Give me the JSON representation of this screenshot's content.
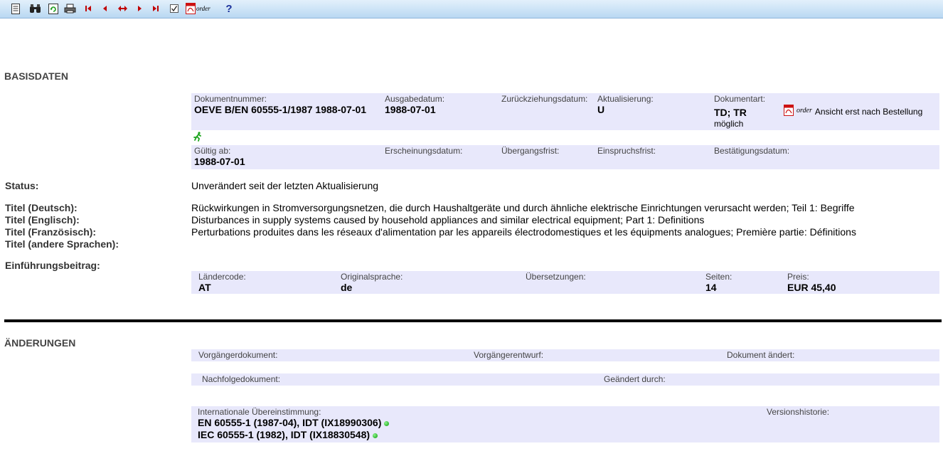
{
  "toolbar": {
    "items": [
      {
        "icon": "document-properties-icon"
      },
      {
        "icon": "binoculars-search-icon"
      },
      {
        "icon": "refresh-icon"
      },
      {
        "icon": "print-icon"
      },
      {
        "icon": "first-record-icon"
      },
      {
        "icon": "previous-record-icon"
      },
      {
        "icon": "switch-icon"
      },
      {
        "icon": "next-record-icon"
      },
      {
        "icon": "last-record-icon"
      },
      {
        "icon": "checkbox-icon"
      },
      {
        "icon": "pdf-icon"
      }
    ],
    "order_label": "order",
    "help_label": "?"
  },
  "basisdaten": {
    "title": "BASISDATEN",
    "dokumentnummer_label": "Dokumentnummer:",
    "dokumentnummer_value": "OEVE B/EN 60555-1/1987 1988-07-01",
    "ausgabedatum_label": "Ausgabedatum:",
    "ausgabedatum_value": "1988-07-01",
    "zurueckziehungsdatum_label": "Zurückziehungsdatum:",
    "aktualisierung_label": "Aktualisierung:",
    "aktualisierung_value": "U",
    "dokumentart_label": "Dokumentart:",
    "dokumentart_value": "TD; TR",
    "dokumentart_note": "möglich",
    "order_label": "order",
    "order_note": "Ansicht erst nach Bestellung",
    "gueltig_label": "Gültig ab:",
    "gueltig_value": "1988-07-01",
    "erscheinungsdatum_label": "Erscheinungsdatum:",
    "uebergangsfrist_label": "Übergangsfrist:",
    "einspruchsfrist_label": "Einspruchsfrist:",
    "bestaetigungsdatum_label": "Bestätigungsdatum:",
    "status_label": "Status:",
    "status_value": "Unverändert seit der letzten Aktualisierung",
    "titel_de_label": "Titel (Deutsch):",
    "titel_de_value": "Rückwirkungen in Stromversorgungsnetzen, die durch Haushaltgeräte und durch ähnliche elektrische Einrichtungen verursacht werden; Teil 1: Begriffe",
    "titel_en_label": "Titel (Englisch):",
    "titel_en_value": "Disturbances in supply systems caused by household appliances and similar electrical equipment; Part 1: Definitions",
    "titel_fr_label": "Titel (Französisch):",
    "titel_fr_value": "Perturbations produites dans les réseaux d'alimentation par les appareils électrodomestiques et les équipments analogues; Première partie: Définitions",
    "titel_other_label": "Titel (andere Sprachen):",
    "einfuehrung_label": "Einführungsbeitrag:",
    "laendercode_label": "Ländercode:",
    "laendercode_value": "AT",
    "originalsprache_label": "Originalsprache:",
    "originalsprache_value": "de",
    "uebersetzungen_label": "Übersetzungen:",
    "seiten_label": "Seiten:",
    "seiten_value": "14",
    "preis_label": "Preis:",
    "preis_value": "EUR 45,40"
  },
  "aenderungen": {
    "title": "ÄNDERUNGEN",
    "vorgaenger_label": "Vorgängerdokument:",
    "vorgaengerentwurf_label": "Vorgängerentwurf:",
    "dokument_aendert_label": "Dokument ändert:",
    "nachfolge_label": "Nachfolgedokument:",
    "geaendert_label": "Geändert durch:",
    "international_label": "Internationale Übereinstimmung:",
    "international_items": [
      "EN 60555-1 (1987-04), IDT (IX18990306)",
      "IEC 60555-1 (1982), IDT (IX18830548)"
    ],
    "versionshistorie_label": "Versionshistorie:"
  },
  "colors": {
    "box": "#e8e8fb",
    "toolbar_top": "#e3f0fb",
    "toolbar_bottom": "#b9d8f2",
    "status_dot": "#0a9a0a",
    "pdf_red": "#cc1111",
    "nav_red": "#c00000"
  }
}
